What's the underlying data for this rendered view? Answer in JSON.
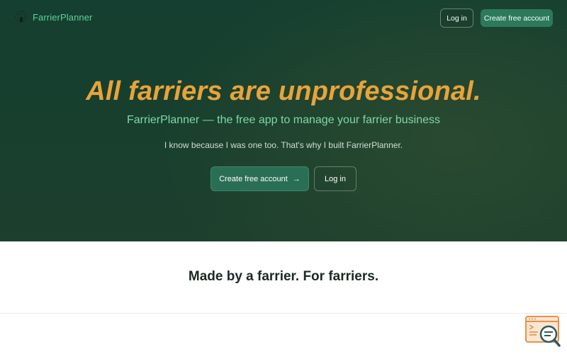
{
  "header": {
    "logo_icon": "horseshoe-icon",
    "brand": "FarrierPlanner",
    "login_label": "Log in",
    "create_label": "Create free account"
  },
  "hero": {
    "headline": "All farriers are unprofessional.",
    "subheadline": "FarrierPlanner — the free app to manage your farrier business",
    "tagline": "I know because I was one too. That's why I built FarrierPlanner.",
    "cta_create_label": "Create free account",
    "cta_arrow_icon": "arrow-right-icon",
    "cta_login_label": "Log in"
  },
  "section": {
    "title": "Made by a farrier. For farriers."
  },
  "widget": {
    "icon": "search-console-icon"
  },
  "colors": {
    "hero_bg": "#183f2e",
    "accent_orange": "#e9a33a",
    "accent_green": "#7fd8a7",
    "brand_green": "#5fd29a",
    "button_green": "#2b7a5c"
  }
}
